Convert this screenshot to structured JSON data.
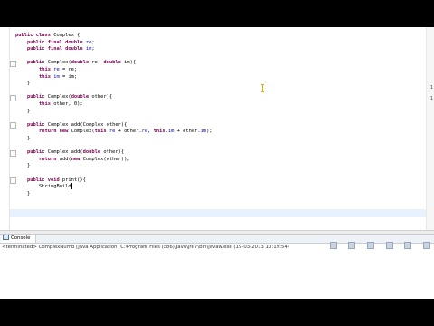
{
  "editor": {
    "lines": [
      {
        "indent": "",
        "parts": [
          {
            "t": "public class",
            "c": "kw"
          },
          {
            "t": " Complex {"
          }
        ]
      },
      {
        "indent": "    ",
        "parts": [
          {
            "t": "public final double",
            "c": "kw"
          },
          {
            "t": " "
          },
          {
            "t": "re",
            "c": "fld"
          },
          {
            "t": ";"
          }
        ]
      },
      {
        "indent": "    ",
        "parts": [
          {
            "t": "public final double",
            "c": "kw"
          },
          {
            "t": " "
          },
          {
            "t": "im",
            "c": "fld"
          },
          {
            "t": ";"
          }
        ]
      },
      {
        "indent": "",
        "parts": []
      },
      {
        "indent": "    ",
        "parts": [
          {
            "t": "public",
            "c": "kw"
          },
          {
            "t": " Complex("
          },
          {
            "t": "double",
            "c": "kw"
          },
          {
            "t": " re, "
          },
          {
            "t": "double",
            "c": "kw"
          },
          {
            "t": " im){"
          }
        ]
      },
      {
        "indent": "        ",
        "parts": [
          {
            "t": "this",
            "c": "kw"
          },
          {
            "t": "."
          },
          {
            "t": "re",
            "c": "fld"
          },
          {
            "t": " = re;"
          }
        ]
      },
      {
        "indent": "        ",
        "parts": [
          {
            "t": "this",
            "c": "kw"
          },
          {
            "t": "."
          },
          {
            "t": "im",
            "c": "fld"
          },
          {
            "t": " = im;"
          }
        ]
      },
      {
        "indent": "    ",
        "parts": [
          {
            "t": "}"
          }
        ]
      },
      {
        "indent": "",
        "parts": []
      },
      {
        "indent": "    ",
        "parts": [
          {
            "t": "public",
            "c": "kw"
          },
          {
            "t": " Complex("
          },
          {
            "t": "double",
            "c": "kw"
          },
          {
            "t": " other){"
          }
        ]
      },
      {
        "indent": "        ",
        "parts": [
          {
            "t": "this",
            "c": "kw"
          },
          {
            "t": "(other, 0);"
          }
        ]
      },
      {
        "indent": "    ",
        "parts": [
          {
            "t": "}"
          }
        ]
      },
      {
        "indent": "",
        "parts": []
      },
      {
        "indent": "    ",
        "parts": [
          {
            "t": "public",
            "c": "kw"
          },
          {
            "t": " Complex add(Complex other){"
          }
        ]
      },
      {
        "indent": "        ",
        "parts": [
          {
            "t": "return new",
            "c": "kw"
          },
          {
            "t": " Complex("
          },
          {
            "t": "this",
            "c": "kw"
          },
          {
            "t": "."
          },
          {
            "t": "re",
            "c": "fld"
          },
          {
            "t": " + other."
          },
          {
            "t": "re",
            "c": "fld"
          },
          {
            "t": ", "
          },
          {
            "t": "this",
            "c": "kw"
          },
          {
            "t": "."
          },
          {
            "t": "im",
            "c": "fld"
          },
          {
            "t": " + other."
          },
          {
            "t": "im",
            "c": "fld"
          },
          {
            "t": ");"
          }
        ]
      },
      {
        "indent": "    ",
        "parts": [
          {
            "t": "}"
          }
        ]
      },
      {
        "indent": "",
        "parts": []
      },
      {
        "indent": "    ",
        "parts": [
          {
            "t": "public",
            "c": "kw"
          },
          {
            "t": " Complex add("
          },
          {
            "t": "double",
            "c": "kw"
          },
          {
            "t": " other){"
          }
        ]
      },
      {
        "indent": "        ",
        "parts": [
          {
            "t": "return",
            "c": "kw"
          },
          {
            "t": " add("
          },
          {
            "t": "new",
            "c": "kw"
          },
          {
            "t": " Complex(other));"
          }
        ]
      },
      {
        "indent": "    ",
        "parts": [
          {
            "t": "}"
          }
        ]
      },
      {
        "indent": "",
        "parts": []
      },
      {
        "indent": "    ",
        "parts": [
          {
            "t": "public void",
            "c": "kw"
          },
          {
            "t": " print(){"
          }
        ]
      },
      {
        "indent": "        ",
        "parts": [
          {
            "t": "StringBuild"
          }
        ],
        "caret": true
      },
      {
        "indent": "    ",
        "parts": [
          {
            "t": "}"
          }
        ]
      }
    ],
    "ruler_marks": [
      "1",
      "1"
    ]
  },
  "console": {
    "tab_label": "Console",
    "status": "<terminated> ComplexNumb [Java Application] C:\\Program Files (x86)\\Java\\jre7\\bin\\javaw.exe (19-03-2013 10:19:54)"
  }
}
